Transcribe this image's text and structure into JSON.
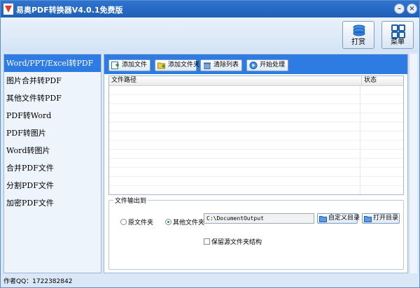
{
  "window": {
    "title": "易奥PDF转换器V4.0.1免费版"
  },
  "top_buttons": {
    "print_label": "打赏",
    "menu_label": "菜单"
  },
  "sidebar": {
    "items": [
      {
        "label": "Word/PPT/Excel转PDF",
        "active": true
      },
      {
        "label": "图片合并转PDF",
        "active": false
      },
      {
        "label": "其他文件转PDF",
        "active": false
      },
      {
        "label": "PDF转Word",
        "active": false
      },
      {
        "label": "PDF转图片",
        "active": false
      },
      {
        "label": "Word转图片",
        "active": false
      },
      {
        "label": "合并PDF文件",
        "active": false
      },
      {
        "label": "分割PDF文件",
        "active": false
      },
      {
        "label": "加密PDF文件",
        "active": false
      }
    ]
  },
  "toolbar": {
    "add_file": "添加文件",
    "add_folder": "添加文件夹",
    "clear_list": "清除列表",
    "start": "开始处理"
  },
  "file_list": {
    "col_path": "文件路径",
    "col_status": "状态",
    "rows": []
  },
  "output": {
    "group_title": "文件输出到",
    "radio_source": "原文件夹",
    "radio_other": "其他文件夹",
    "selected": "other",
    "path_value": "C:\\DocumentOutput",
    "custom_dir_button": "自定义目录",
    "open_dir_button": "打开目录",
    "keep_structure_label": "保留源文件夹结构",
    "keep_structure_checked": false
  },
  "footer": {
    "author": "作者QQ：1722382842"
  },
  "colors": {
    "accent": "#2d7be3",
    "titlebar": "#2f74cf"
  }
}
